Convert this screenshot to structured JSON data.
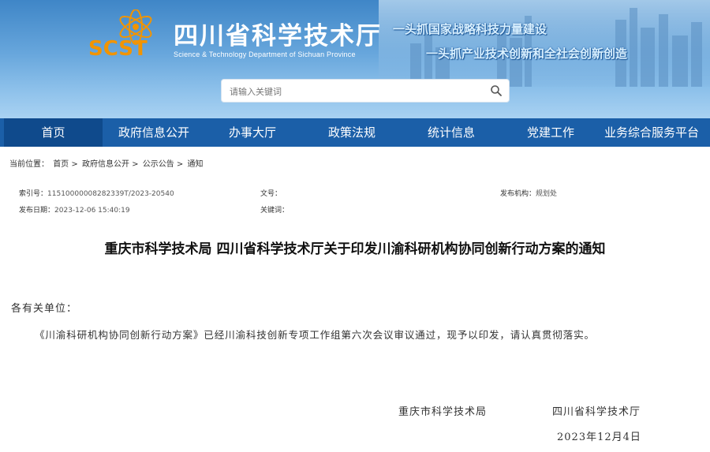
{
  "header": {
    "site_title": "四川省科学技术厅",
    "site_subtitle": "Science & Technology Department of Sichuan Province",
    "logo_text": "SCST",
    "slogan_1": "一头抓国家战略科技力量建设",
    "slogan_2": "一头抓产业技术创新和全社会创新创造",
    "search_placeholder": "请输入关键词"
  },
  "nav": {
    "items": [
      {
        "label": "首页"
      },
      {
        "label": "政府信息公开"
      },
      {
        "label": "办事大厅"
      },
      {
        "label": "政策法规"
      },
      {
        "label": "统计信息"
      },
      {
        "label": "党建工作"
      },
      {
        "label": "业务综合服务平台"
      }
    ]
  },
  "breadcrumb": {
    "prefix": "当前位置：",
    "items": [
      "首页",
      "政府信息公开",
      "公示公告",
      "通知"
    ],
    "separator": ">"
  },
  "meta": {
    "index_label": "索引号：",
    "index_value": "11510000008282339T/2023-20540",
    "doc_no_label": "文号：",
    "doc_no_value": "",
    "publisher_label": "发布机构：",
    "publisher_value": "规划处",
    "date_label": "发布日期：",
    "date_value": "2023-12-06 15:40:19",
    "keywords_label": "关键词：",
    "keywords_value": ""
  },
  "article": {
    "title": "重庆市科学技术局 四川省科学技术厅关于印发川渝科研机构协同创新行动方案的通知",
    "salutation": "各有关单位：",
    "paragraph_1": "《川渝科研机构协同创新行动方案》已经川渝科技创新专项工作组第六次会议审议通过，现予以印发，请认真贯彻落实。",
    "signer_1": "重庆市科学技术局",
    "signer_2": "四川省科学技术厅",
    "sign_date": "2023年12月4日"
  },
  "colors": {
    "header_blue": "#4a90d0",
    "nav_blue": "#1b5fa8",
    "nav_active": "#0f4a8c",
    "logo_orange": "#f29400"
  }
}
